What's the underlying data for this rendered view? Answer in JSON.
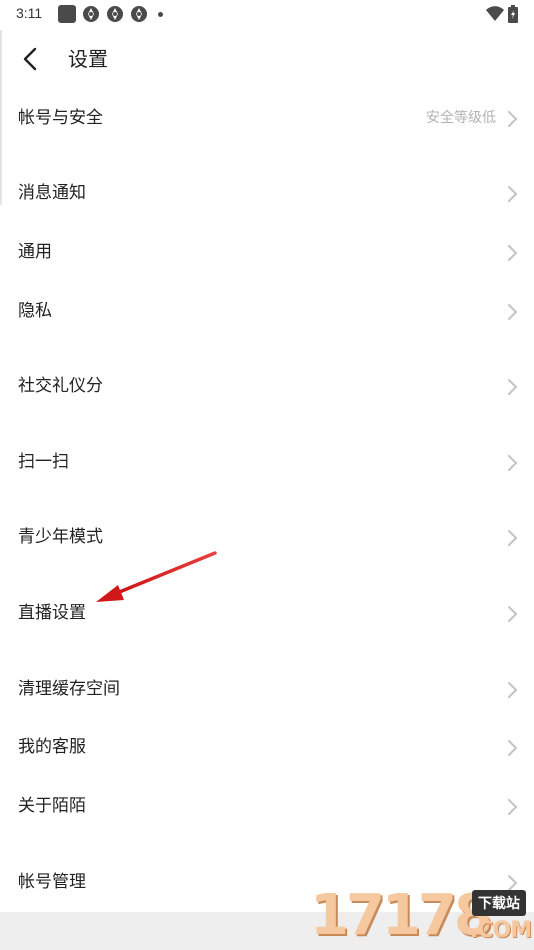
{
  "status_bar": {
    "time": "3:11",
    "icons": [
      "square-notification-icon",
      "aperture-icon",
      "aperture-icon",
      "aperture-icon",
      "more-dot-icon"
    ],
    "right_icons": [
      "wifi-icon",
      "battery-icon"
    ]
  },
  "nav": {
    "title": "设置",
    "back_icon": "chevron-left-icon"
  },
  "settings": {
    "items": [
      {
        "label": "帐号与安全",
        "value": "安全等级低"
      },
      {
        "label": "消息通知"
      },
      {
        "label": "通用"
      },
      {
        "label": "隐私"
      },
      {
        "label": "社交礼仪分"
      },
      {
        "label": "扫一扫"
      },
      {
        "label": "青少年模式"
      },
      {
        "label": "直播设置"
      },
      {
        "label": "清理缓存空间"
      },
      {
        "label": "我的客服"
      },
      {
        "label": "关于陌陌"
      },
      {
        "label": "帐号管理"
      }
    ]
  },
  "annotation": {
    "arrow_color": "#e02020"
  },
  "watermark": {
    "number": "17178",
    "badge": "下载站",
    "suffix": ".COM"
  },
  "colors": {
    "text_primary": "#222222",
    "text_secondary": "#b3b3b3",
    "chevron": "#c4c4c4",
    "background": "#ffffff"
  }
}
